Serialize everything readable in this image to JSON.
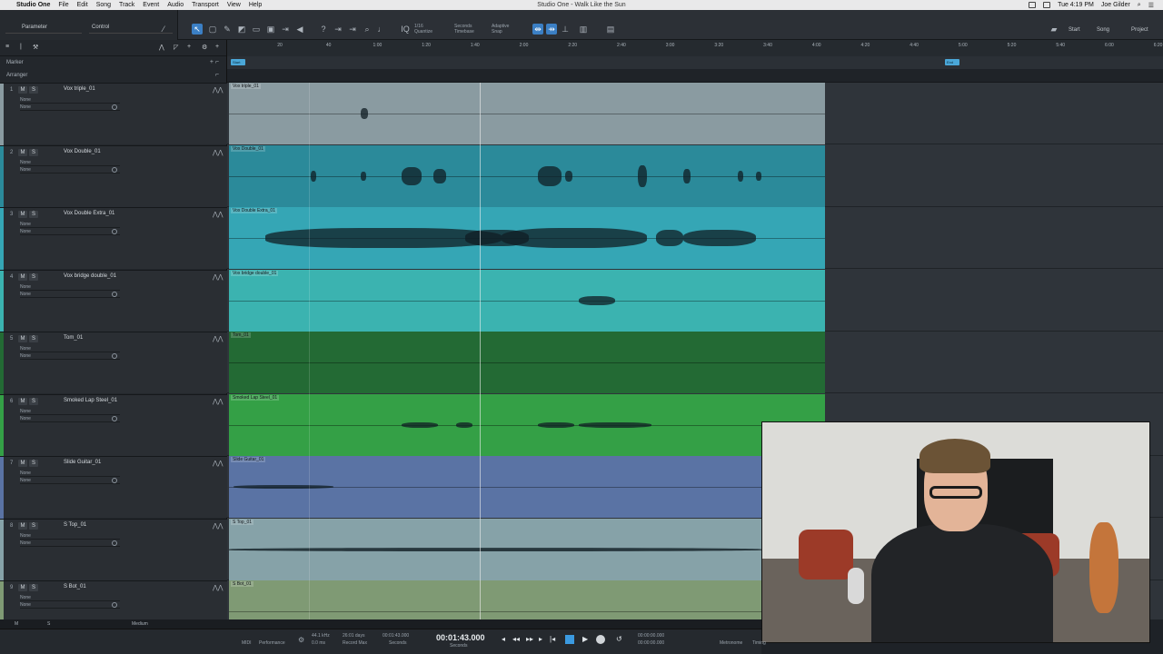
{
  "menubar": {
    "app": "Studio One",
    "items": [
      "File",
      "Edit",
      "Song",
      "Track",
      "Event",
      "Audio",
      "Transport",
      "View",
      "Help"
    ],
    "window_title": "Studio One - Walk Like the Sun",
    "clock": "Tue 4:19 PM",
    "user": "Joe Gilder"
  },
  "toolbar": {
    "parameter_label": "Parameter",
    "control_label": "Control",
    "quantize_value": "1/16",
    "quantize_label": "Quantize",
    "timebase_value": "Seconds",
    "timebase_label": "Timebase",
    "snap_value": "Adaptive",
    "snap_label": "Snap",
    "start_button": "Start",
    "song_button": "Song",
    "project_button": "Project"
  },
  "leftbar": {
    "marker_label": "Marker",
    "arranger_label": "Arranger"
  },
  "ruler": {
    "ticks": [
      "20",
      "40",
      "1:00",
      "1:20",
      "1:40",
      "2:00",
      "2:20",
      "2:40",
      "3:00",
      "3:20",
      "3:40",
      "4:00",
      "4:20",
      "4:40",
      "5:00",
      "5:20",
      "5:40",
      "6:00",
      "6:20"
    ],
    "start_marker": "Start",
    "end_marker": "End"
  },
  "tracks": [
    {
      "num": "1",
      "name": "Vox triple_01",
      "clip": "Vox triple_01",
      "io1": "None",
      "io2": "None",
      "color": "#8a9ba1",
      "strip": "#8a9ba1"
    },
    {
      "num": "2",
      "name": "Vox Double_01",
      "clip": "Vox Double_01",
      "io1": "None",
      "io2": "None",
      "color": "#2b8a9a",
      "strip": "#2b8a9a"
    },
    {
      "num": "3",
      "name": "Vox Double Extra_01",
      "clip": "Vox Double Extra_01",
      "io1": "None",
      "io2": "None",
      "color": "#35a6b5",
      "strip": "#35a6b5"
    },
    {
      "num": "4",
      "name": "Vox bridge double_01",
      "clip": "Vox bridge double_01",
      "io1": "None",
      "io2": "None",
      "color": "#3bb3b0",
      "strip": "#3bb3b0"
    },
    {
      "num": "5",
      "name": "Tom_01",
      "clip": "Tom_01",
      "io1": "None",
      "io2": "None",
      "color": "#236a34",
      "strip": "#236a34"
    },
    {
      "num": "6",
      "name": "Smoked Lap Steel_01",
      "clip": "Smoked Lap Steel_01",
      "io1": "None",
      "io2": "None",
      "color": "#34a046",
      "strip": "#34a046"
    },
    {
      "num": "7",
      "name": "Slide Guitar_01",
      "clip": "Slide Guitar_01",
      "io1": "None",
      "io2": "None",
      "color": "#5a73a4",
      "strip": "#5a73a4"
    },
    {
      "num": "8",
      "name": "S Top_01",
      "clip": "S Top_01",
      "io1": "None",
      "io2": "None",
      "color": "#86a2a8",
      "strip": "#86a2a8"
    },
    {
      "num": "9",
      "name": "S Bot_01",
      "clip": "S Bot_01",
      "io1": "None",
      "io2": "None",
      "color": "#7f9a74",
      "strip": "#7f9a74"
    }
  ],
  "track_buttons": {
    "mute": "M",
    "solo": "S"
  },
  "status": {
    "left": "M",
    "mid": "S",
    "size": "Medium"
  },
  "transport": {
    "midi": "MIDI",
    "performance": "Performance",
    "sample_rate": "44.1 kHz",
    "latency": "0.0 ms",
    "record_max": "26:01 days",
    "record_max_label": "Record Max",
    "seconds_small": "00:01:43.000",
    "seconds_label": "Seconds",
    "main_time": "00:01:43.000",
    "main_time_label": "Seconds",
    "loop_start": "00:00:00.000",
    "loop_end": "00:00:00.000",
    "metronome": "Metronome",
    "timing": "Timing"
  }
}
